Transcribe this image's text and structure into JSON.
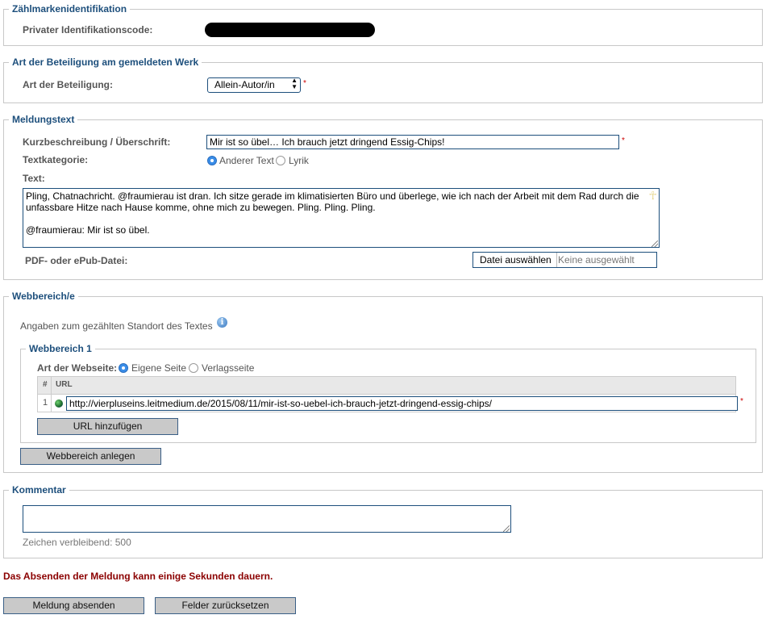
{
  "sections": {
    "identification": {
      "legend": "Zählmarkenidentifikation",
      "label": "Privater Identifikationscode:"
    },
    "participation": {
      "legend": "Art der Beteiligung am gemeldeten Werk",
      "label": "Art der Beteiligung:",
      "selected": "Allein-Autor/in",
      "required_mark": "*"
    },
    "message": {
      "legend": "Meldungstext",
      "title_label": "Kurzbeschreibung / Überschrift:",
      "title_value": "Mir ist so übel… Ich brauch jetzt dringend Essig-Chips!",
      "required_mark": "*",
      "category_label": "Textkategorie:",
      "category_options": [
        "Anderer Text",
        "Lyrik"
      ],
      "text_label": "Text:",
      "text_line1": "Pling, Chatnachricht. @fraumierau ist dran. Ich sitze gerade im klimatisierten Büro und überlege, wie ich nach der Arbeit mit dem Rad durch die",
      "text_line2": "unfassbare Hitze nach Hause komme, ohne mich zu bewegen. Pling. Pling. Pling.",
      "text_line3": "@fraumierau: Mir ist so übel.",
      "file_label": "PDF- oder ePub-Datei:",
      "file_button": "Datei auswählen",
      "file_status": "Keine ausgewählt"
    },
    "web": {
      "legend": "Webbereich/e",
      "info": "Angaben zum gezählten Standort des Textes",
      "area_legend": "Webbereich 1",
      "site_type_label": "Art der Webseite:",
      "site_options": [
        "Eigene Seite",
        "Verlagsseite"
      ],
      "table_headers": [
        "#",
        "URL"
      ],
      "rows": [
        {
          "num": "1",
          "url": "http://vierpluseins.leitmedium.de/2015/08/11/mir-ist-so-uebel-ich-brauch-jetzt-dringend-essig-chips/"
        }
      ],
      "required_mark": "*",
      "add_url_button": "URL hinzufügen",
      "add_area_button": "Webbereich anlegen"
    },
    "comment": {
      "legend": "Kommentar",
      "remaining": "Zeichen verbleibend: 500"
    }
  },
  "warning": "Das Absenden der Meldung kann einige Sekunden dauern.",
  "buttons": {
    "submit": "Meldung absenden",
    "reset": "Felder zurücksetzen"
  },
  "colors": {
    "legend": "#1d4f7c",
    "warning": "#8b0000",
    "required": "#cc0000",
    "radio_selected": "#3a8de8",
    "button_bg": "#c9c9c9"
  }
}
